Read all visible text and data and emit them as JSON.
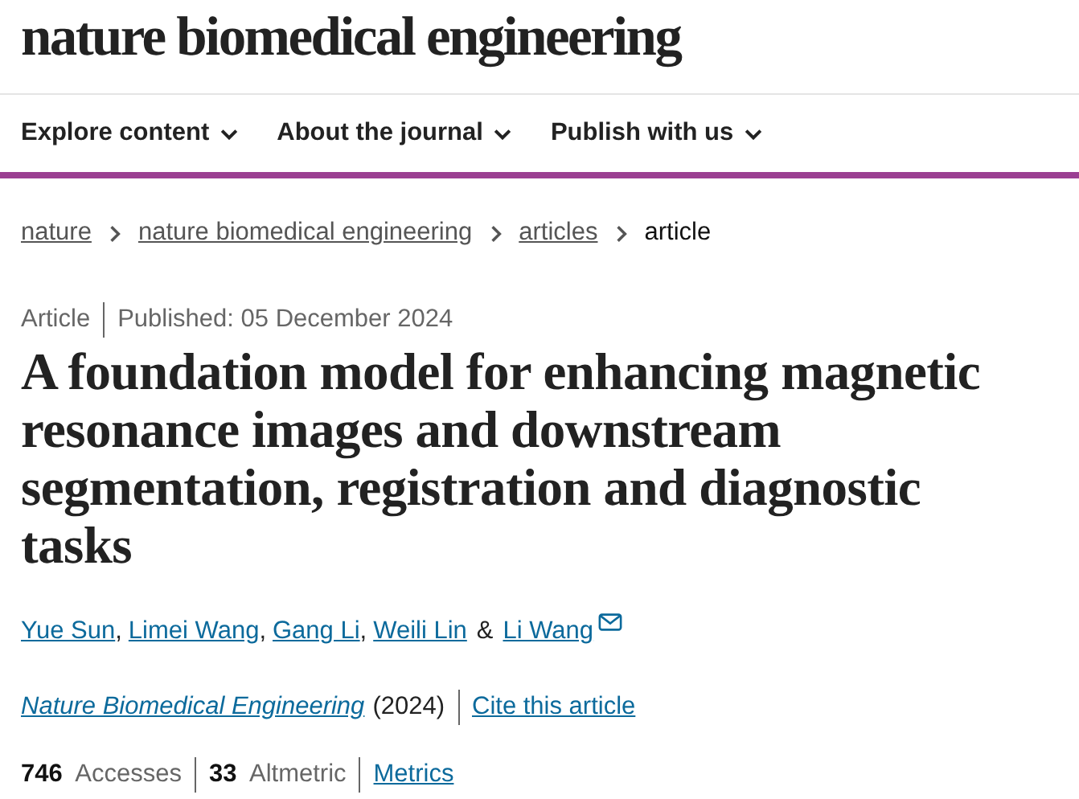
{
  "logo": "nature biomedical engineering",
  "nav": [
    {
      "label": "Explore content"
    },
    {
      "label": "About the journal"
    },
    {
      "label": "Publish with us"
    }
  ],
  "breadcrumb": [
    {
      "label": "nature",
      "current": false
    },
    {
      "label": "nature biomedical engineering",
      "current": false
    },
    {
      "label": "articles",
      "current": false
    },
    {
      "label": "article",
      "current": true
    }
  ],
  "article": {
    "type": "Article",
    "published": "Published: 05 December 2024",
    "title": "A foundation model for enhancing magnetic resonance images and downstream segmentation, registration and diagnostic tasks",
    "authors": [
      {
        "name": "Yue Sun",
        "separator": ",",
        "email": false
      },
      {
        "name": "Limei Wang",
        "separator": ",",
        "email": false
      },
      {
        "name": "Gang Li",
        "separator": ",",
        "email": false
      },
      {
        "name": "Weili Lin",
        "separator": "&",
        "email": false
      },
      {
        "name": "Li Wang",
        "email": true
      }
    ],
    "journal": "Nature Biomedical Engineering",
    "year": "(2024)",
    "cite": "Cite this article",
    "metrics": [
      {
        "stat": "**746**  Accesses"
      },
      {
        "stat": "**33**  Altmetric"
      }
    ],
    "metrics_link": "Metrics"
  }
}
